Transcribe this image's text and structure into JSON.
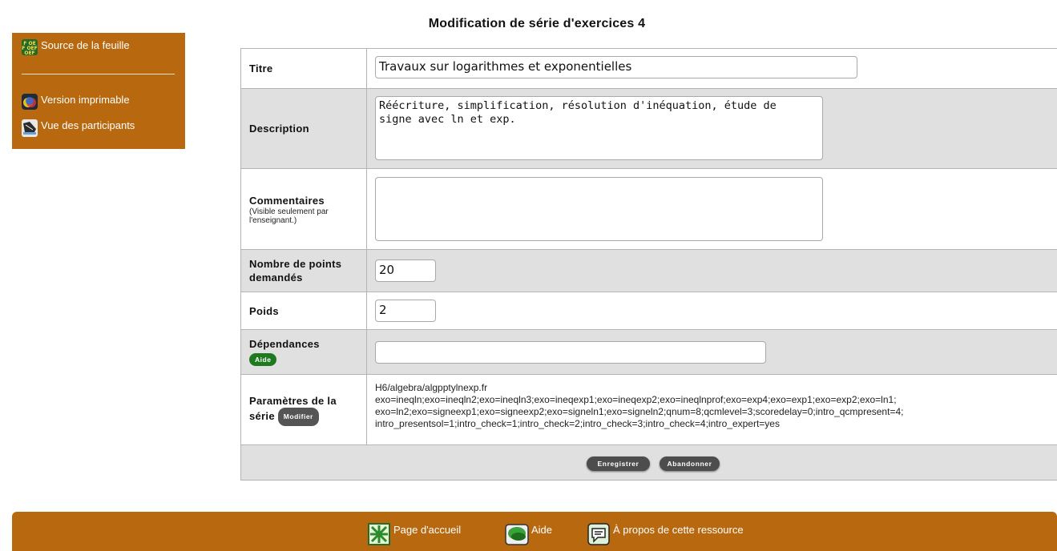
{
  "page": {
    "title": "Modification de série d'exercices 4"
  },
  "side_menu": {
    "items": [
      {
        "label": "Source de la feuille",
        "icon": "oef-source-icon"
      },
      {
        "label": "Version imprimable",
        "icon": "print-version-icon"
      },
      {
        "label": "Vue des participants",
        "icon": "participants-view-icon"
      }
    ]
  },
  "form": {
    "titre": {
      "label": "Titre",
      "value": "Travaux sur logarithmes et exponentielles"
    },
    "description": {
      "label": "Description",
      "value": "Réécriture, simplification, résolution d'inéquation, étude de\nsigne avec ln et exp."
    },
    "commentaires": {
      "label": "Commentaires",
      "note": "(Visible seulement par l'enseignant.)",
      "value": ""
    },
    "points": {
      "label": "Nombre de points demandés",
      "value": "20"
    },
    "poids": {
      "label": "Poids",
      "value": "2"
    },
    "dependances": {
      "label": "Dépendances",
      "help_label": "Aide",
      "value": ""
    },
    "parametres": {
      "label_line1": "Paramètres de la",
      "label_line2": "série",
      "modify_label": "Modifier",
      "lines": [
        "H6/algebra/algpptylnexp.fr",
        "exo=ineqln;exo=ineqln2;exo=ineqln3;exo=ineqexp1;exo=ineqexp2;exo=ineqlnprof;exo=exp4;exo=exp1;exo=exp2;exo=ln1;",
        "exo=ln2;exo=signeexp1;exo=signeexp2;exo=signeln1;exo=signeln2;qnum=8;qcmlevel=3;scoredelay=0;intro_qcmpresent=4;",
        "intro_presentsol=1;intro_check=1;intro_check=2;intro_check=3;intro_check=4;intro_expert=yes"
      ]
    },
    "actions": {
      "save_label": "Enregistrer",
      "cancel_label": "Abandonner"
    }
  },
  "footer": {
    "items": [
      {
        "label": "Page d'accueil",
        "icon": "home-icon"
      },
      {
        "label": "Aide",
        "icon": "help-icon"
      },
      {
        "label": "À propos de cette ressource",
        "icon": "about-icon"
      }
    ]
  },
  "colors": {
    "brand": "#b8690f",
    "row_grey": "#e0e0e0",
    "help_green": "#1e7a1e",
    "button_dark": "#4d4d4d"
  }
}
